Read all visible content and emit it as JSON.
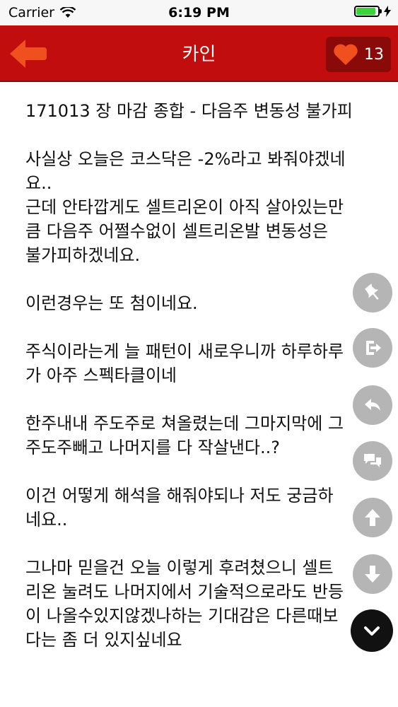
{
  "status_bar": {
    "carrier": "Carrier",
    "time": "6:19 PM",
    "battery_level": 0.9
  },
  "header": {
    "title": "카인",
    "like_count": "13"
  },
  "post": {
    "title_line": "171013 장 마감 종합 - 다음주 변동성 불가피",
    "paragraphs": [
      "사실상 오늘은 코스닥은 -2%라고 봐줘야겠네\n요..\n근데 안타깝게도 셀트리온이 아직 살아있는만\n큼 다음주 어쩔수없이 셀트리온발 변동성은\n불가피하겠네요.",
      "이런경우는 또 첨이네요.",
      "주식이라는게 늘 패턴이 새로우니까 하루하루\n가 아주 스펙타클이네",
      "한주내내 주도주로 쳐올렸는데 그마지막에 그\n주도주빼고 나머지를 다 작살낸다..?",
      "이건 어떻게 해석을 해줘야되나 저도 궁금하\n네요..",
      "그나마 믿을건 오늘 이렇게 후려쳤으니 셀트\n리온 눌려도 나머지에서 기술적으로라도 반등\n이 나올수있지않겠나하는 기대감은 다른때보\n다는 좀 더 있지싶네요"
    ]
  },
  "colors": {
    "header_red": "#c10d0d",
    "accent_orange": "#f0501e"
  },
  "icons": {
    "back": "arrow-left-icon",
    "like": "heart-icon",
    "pin": "pin-icon",
    "share": "share-icon",
    "reply": "reply-icon",
    "comment": "comment-icon",
    "up": "arrow-up-icon",
    "down": "arrow-down-icon",
    "collapse": "chevron-down-icon"
  }
}
